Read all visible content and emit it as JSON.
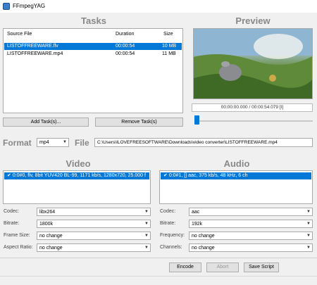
{
  "window": {
    "title": "FFmpegYAG"
  },
  "tasks": {
    "title": "Tasks",
    "columns": [
      "Source File",
      "Duration",
      "Size"
    ],
    "rows": [
      {
        "file": "LISTOFFREEWARE.flv",
        "duration": "00:00:54",
        "size": "10 MB",
        "selected": true
      },
      {
        "file": "LISTOFFREEWARE.mp4",
        "duration": "00:00:54",
        "size": "11 MB",
        "selected": false
      }
    ],
    "add_label": "Add Task(s)...",
    "remove_label": "Remove Task(s)"
  },
  "preview": {
    "title": "Preview",
    "time": "00:00:00.000 / 00:00:54.079 [I]",
    "slider_position": 0.02
  },
  "format": {
    "label": "Format",
    "value": "mp4",
    "file_label": "File",
    "file_path": "C:\\Users\\ILOVEFREESOFTWARE\\Downloads\\video converter\\LISTOFFREEWARE.mp4"
  },
  "video": {
    "title": "Video",
    "stream": "0:0#0, flv, 8bit YUV420 BL-99, 1171 kb/s, 1280x720, 25.000 f",
    "codec_label": "Codec:",
    "codec": "libx264",
    "bitrate_label": "Bitrate:",
    "bitrate": "1800k",
    "framesize_label": "Frame Size:",
    "framesize": "no change",
    "aspect_label": "Aspect Ratio:",
    "aspect": "no change"
  },
  "audio": {
    "title": "Audio",
    "stream": "0:0#1, [] aac, 375 kb/s, 48 kHz, 6 ch",
    "codec_label": "Codec:",
    "codec": "aac",
    "bitrate_label": "Bitrate:",
    "bitrate": "192k",
    "frequency_label": "Frequency:",
    "frequency": "no change",
    "channels_label": "Channels:",
    "channels": "no change"
  },
  "actions": {
    "encode": "Encode",
    "abort": "Abort",
    "save_script": "Save Script"
  }
}
